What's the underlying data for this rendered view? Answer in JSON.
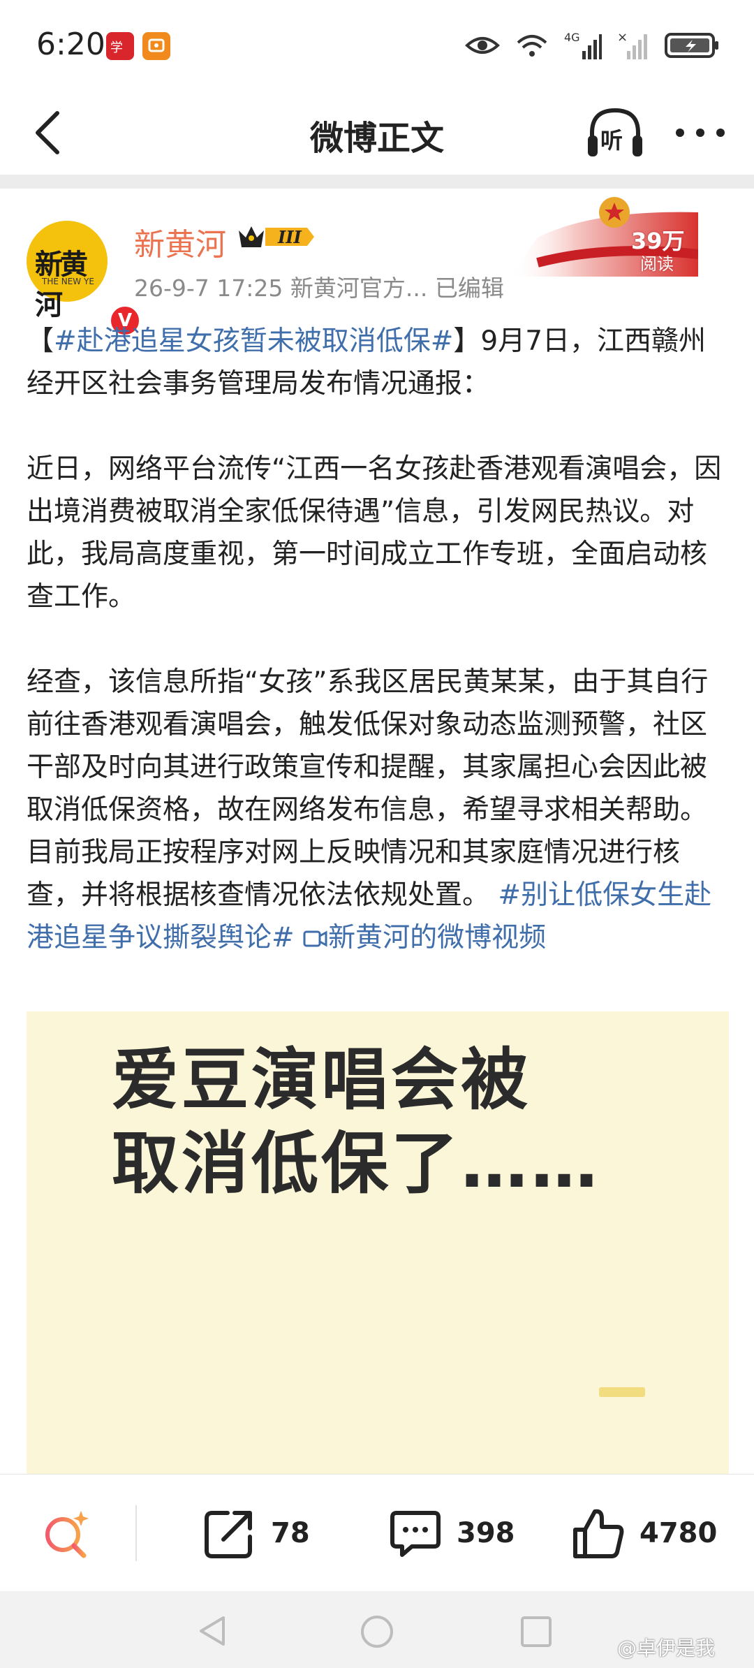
{
  "status_bar": {
    "time": "6:20"
  },
  "nav": {
    "title": "微博正文",
    "listen_label": "听"
  },
  "post": {
    "author": "新黄河",
    "level_badge": "III",
    "avatar_text": "新黄河",
    "avatar_sub": "THE NEW YE",
    "verified": "V",
    "meta": "26-9-7 17:25  新黄河官方...  已编辑",
    "reads": {
      "count": "39万",
      "label": "阅读"
    },
    "p1_bracket_open": "【",
    "p1_tag": "#赴港追星女孩暂未被取消低保#",
    "p1_rest": "】9月7日，江西赣州经开区社会事务管理局发布情况通报：",
    "p2": "近日，网络平台流传“江西一名女孩赴香港观看演唱会，因出境消费被取消全家低保待遇”信息，引发网民热议。对此，我局高度重视，第一时间成立工作专班，全面启动核查工作。",
    "p3": "经查，该信息所指“女孩”系我区居民黄某某，由于其自行前往香港观看演唱会，触发低保对象动态监测预警，社区干部及时向其进行政策宣传和提醒，其家属担心会因此被取消低保资格，故在网络发布信息，希望寻求相关帮助。目前我局正按程序对网上反映情况和其家庭情况进行核查，并将根据核查情况依法依规处置。",
    "p3_tag": "#别让低保女生赴港追星争议撕裂舆论#",
    "video_link": "新黄河的微博视频",
    "image_text_line1": "爱豆演唱会被",
    "image_text_line2": "取消低保了……"
  },
  "actions": {
    "reposts": "78",
    "comments": "398",
    "likes": "4780"
  },
  "watermark": "@卓伊是我",
  "colors": {
    "link": "#3f6eab",
    "username": "#eb7350",
    "verified_red": "#e8262b",
    "avatar_yellow": "#f4c10d"
  }
}
